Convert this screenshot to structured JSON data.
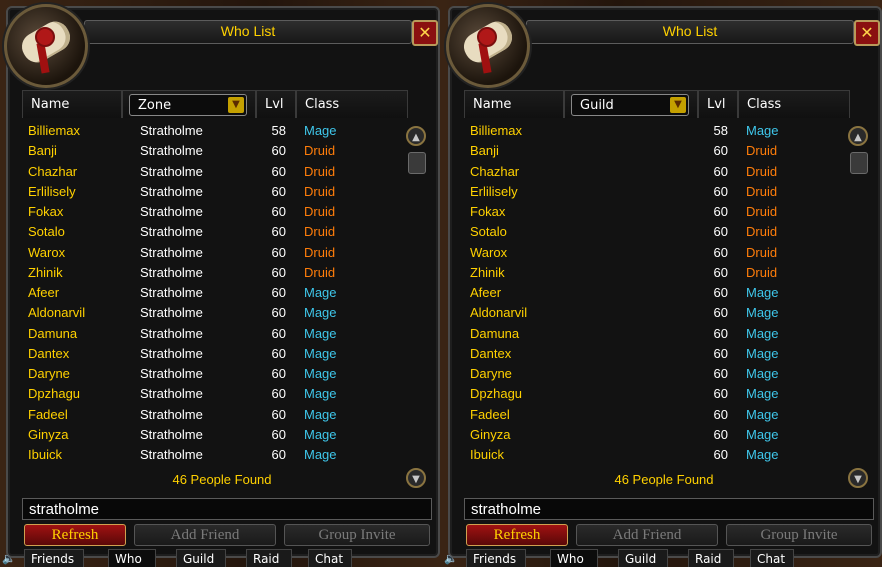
{
  "panels": [
    {
      "title": "Who List",
      "columns": {
        "name": "Name",
        "dropdown": "Zone",
        "lvl": "Lvl",
        "class": "Class"
      },
      "rows": [
        {
          "name": "Billiemax",
          "col2": "Stratholme",
          "lvl": "58",
          "cls": "Mage"
        },
        {
          "name": "Banji",
          "col2": "Stratholme",
          "lvl": "60",
          "cls": "Druid"
        },
        {
          "name": "Chazhar",
          "col2": "Stratholme",
          "lvl": "60",
          "cls": "Druid"
        },
        {
          "name": "Erlilisely",
          "col2": "Stratholme",
          "lvl": "60",
          "cls": "Druid"
        },
        {
          "name": "Fokax",
          "col2": "Stratholme",
          "lvl": "60",
          "cls": "Druid"
        },
        {
          "name": "Sotalo",
          "col2": "Stratholme",
          "lvl": "60",
          "cls": "Druid"
        },
        {
          "name": "Warox",
          "col2": "Stratholme",
          "lvl": "60",
          "cls": "Druid"
        },
        {
          "name": "Zhinik",
          "col2": "Stratholme",
          "lvl": "60",
          "cls": "Druid"
        },
        {
          "name": "Afeer",
          "col2": "Stratholme",
          "lvl": "60",
          "cls": "Mage"
        },
        {
          "name": "Aldonarvil",
          "col2": "Stratholme",
          "lvl": "60",
          "cls": "Mage"
        },
        {
          "name": "Damuna",
          "col2": "Stratholme",
          "lvl": "60",
          "cls": "Mage"
        },
        {
          "name": "Dantex",
          "col2": "Stratholme",
          "lvl": "60",
          "cls": "Mage"
        },
        {
          "name": "Daryne",
          "col2": "Stratholme",
          "lvl": "60",
          "cls": "Mage"
        },
        {
          "name": "Dpzhagu",
          "col2": "Stratholme",
          "lvl": "60",
          "cls": "Mage"
        },
        {
          "name": "Fadeel",
          "col2": "Stratholme",
          "lvl": "60",
          "cls": "Mage"
        },
        {
          "name": "Ginyza",
          "col2": "Stratholme",
          "lvl": "60",
          "cls": "Mage"
        },
        {
          "name": "Ibuick",
          "col2": "Stratholme",
          "lvl": "60",
          "cls": "Mage"
        }
      ],
      "found": "46 People Found",
      "search_value": "stratholme",
      "buttons": {
        "refresh": "Refresh",
        "add_friend": "Add Friend",
        "group_invite": "Group Invite"
      },
      "tabs": [
        "Friends",
        "Who",
        "Guild",
        "Raid",
        "Chat"
      ]
    },
    {
      "title": "Who List",
      "columns": {
        "name": "Name",
        "dropdown": "Guild",
        "lvl": "Lvl",
        "class": "Class"
      },
      "rows": [
        {
          "name": "Billiemax",
          "col2": "",
          "lvl": "58",
          "cls": "Mage"
        },
        {
          "name": "Banji",
          "col2": "",
          "lvl": "60",
          "cls": "Druid"
        },
        {
          "name": "Chazhar",
          "col2": "",
          "lvl": "60",
          "cls": "Druid"
        },
        {
          "name": "Erlilisely",
          "col2": "",
          "lvl": "60",
          "cls": "Druid"
        },
        {
          "name": "Fokax",
          "col2": "",
          "lvl": "60",
          "cls": "Druid"
        },
        {
          "name": "Sotalo",
          "col2": "",
          "lvl": "60",
          "cls": "Druid"
        },
        {
          "name": "Warox",
          "col2": "",
          "lvl": "60",
          "cls": "Druid"
        },
        {
          "name": "Zhinik",
          "col2": "",
          "lvl": "60",
          "cls": "Druid"
        },
        {
          "name": "Afeer",
          "col2": "",
          "lvl": "60",
          "cls": "Mage"
        },
        {
          "name": "Aldonarvil",
          "col2": "",
          "lvl": "60",
          "cls": "Mage"
        },
        {
          "name": "Damuna",
          "col2": "",
          "lvl": "60",
          "cls": "Mage"
        },
        {
          "name": "Dantex",
          "col2": "",
          "lvl": "60",
          "cls": "Mage"
        },
        {
          "name": "Daryne",
          "col2": "",
          "lvl": "60",
          "cls": "Mage"
        },
        {
          "name": "Dpzhagu",
          "col2": "",
          "lvl": "60",
          "cls": "Mage"
        },
        {
          "name": "Fadeel",
          "col2": "",
          "lvl": "60",
          "cls": "Mage"
        },
        {
          "name": "Ginyza",
          "col2": "",
          "lvl": "60",
          "cls": "Mage"
        },
        {
          "name": "Ibuick",
          "col2": "",
          "lvl": "60",
          "cls": "Mage"
        }
      ],
      "found": "46 People Found",
      "search_value": "stratholme",
      "buttons": {
        "refresh": "Refresh",
        "add_friend": "Add Friend",
        "group_invite": "Group Invite"
      },
      "tabs": [
        "Friends",
        "Who",
        "Guild",
        "Raid",
        "Chat"
      ]
    }
  ],
  "icons": {
    "portrait": "scroll-seal-icon",
    "close": "close-icon",
    "dropdown": "chevron-down-icon",
    "scroll_up": "arrow-up-icon",
    "scroll_down": "arrow-down-icon",
    "speaker": "speaker-icon"
  },
  "colors": {
    "title": "#ffd100",
    "name": "#ffd100",
    "mage": "#3fc7eb",
    "druid": "#ff7d0a",
    "refresh_button": "#a01212"
  }
}
